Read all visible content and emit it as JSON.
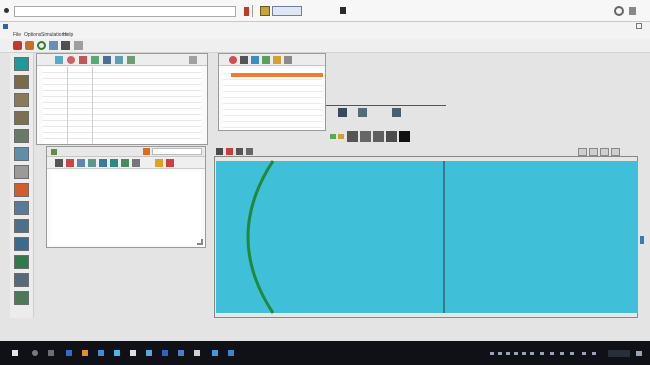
{
  "app": {
    "window_title": "",
    "menu": [
      "File",
      "Options",
      "Simulations",
      "Help"
    ]
  },
  "panels": {
    "loss_panel_title": "",
    "bottom_panel_title": "",
    "label_a": "",
    "label_b": "",
    "label_c": "",
    "label_d": ""
  },
  "icons": {
    "palette": [
      "#1e9a9a",
      "#c0392b",
      "#e08a1e",
      "#2e7d32",
      "#6b6b6b",
      "#3465a4"
    ]
  },
  "colors": {
    "canvas_fill": "#3fbfd8",
    "canvas_arc": "#1f8a3a",
    "taskbar": "#0f1117",
    "highlight_row": "#f07b2c"
  }
}
